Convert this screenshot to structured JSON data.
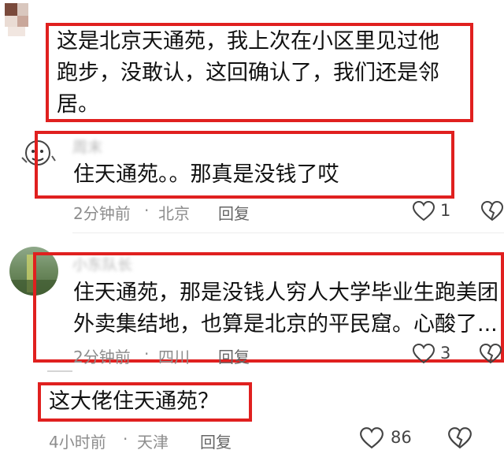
{
  "comments": [
    {
      "text_lines": [
        "这是北京天通苑，我上次在小区里见过他",
        "跑步，没敢认，这回确认了，我们还是邻",
        "居。"
      ]
    },
    {
      "username": "周末",
      "text": "住天通苑。。那真是没钱了哎",
      "time": "2分钟前",
      "location": "北京",
      "reply_label": "回复",
      "likes": "1"
    },
    {
      "username": "小东队长",
      "text_lines": [
        "住天通苑，那是没钱人穷人大学毕业生跑美团",
        "外卖集结地，也算是北京的平民窟。心酸了..."
      ],
      "time": "2分钟前",
      "location": "四川",
      "reply_label": "回复",
      "likes": "3"
    },
    {
      "text": "这大佬住天通苑？",
      "time": "4小时前",
      "location": "天津",
      "reply_label": "回复",
      "likes": "86"
    }
  ],
  "colors": {
    "highlight": "#e0201f",
    "meta": "#8d8d8d"
  }
}
